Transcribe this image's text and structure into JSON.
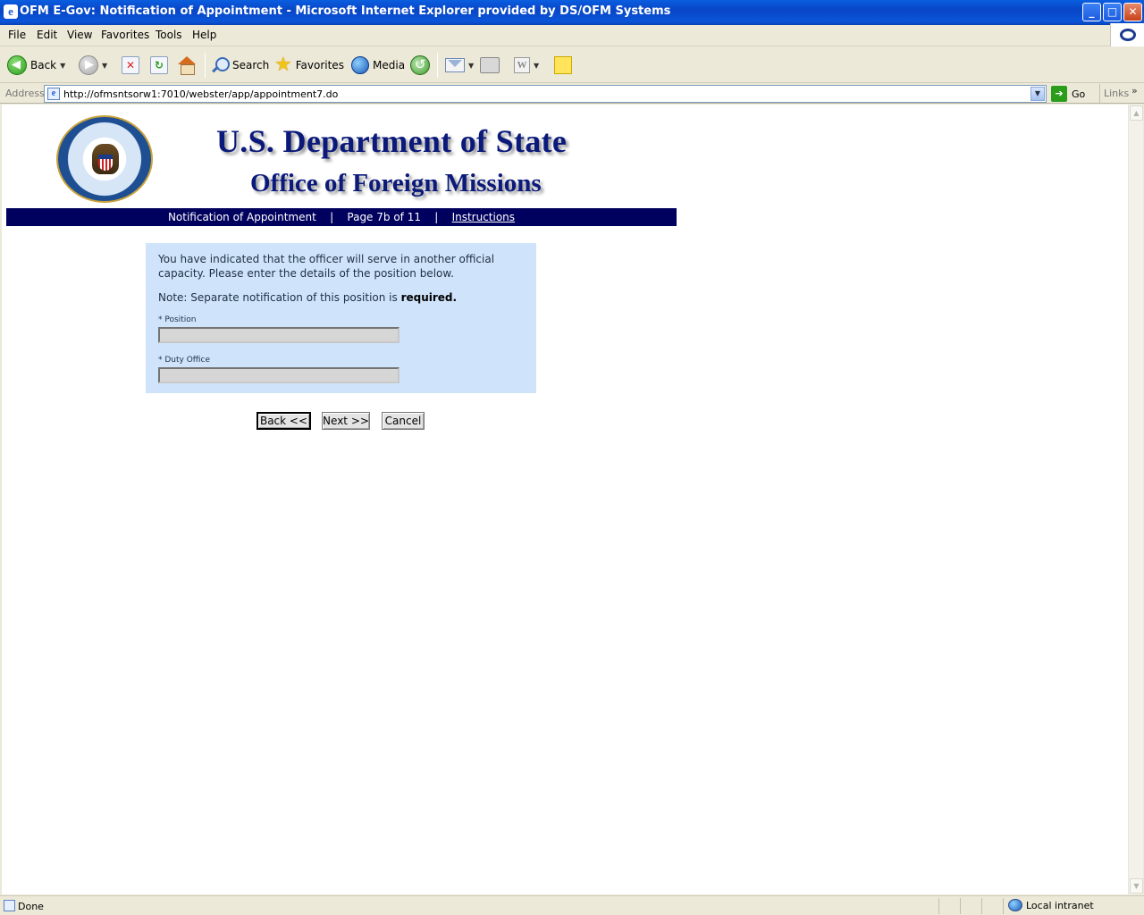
{
  "window": {
    "title": "OFM E-Gov: Notification of Appointment - Microsoft Internet Explorer provided by DS/OFM Systems",
    "controls": {
      "minimize": "_",
      "maximize": "□",
      "close": "✕"
    }
  },
  "menu": {
    "items": [
      "File",
      "Edit",
      "View",
      "Favorites",
      "Tools",
      "Help"
    ]
  },
  "toolbar": {
    "back_label": "Back",
    "search_label": "Search",
    "favorites_label": "Favorites",
    "media_label": "Media"
  },
  "address": {
    "label": "Address",
    "url": "http://ofmsntsorw1:7010/webster/app/appointment7.do",
    "go_label": "Go",
    "links_label": "Links",
    "links_chevron": "»"
  },
  "page": {
    "header": {
      "dept_title": "U.S. Department of State",
      "office_title": "Office of Foreign Missions"
    },
    "nav": {
      "section": "Notification of Appointment",
      "separator": "|",
      "page": "Page 7b of 11",
      "instructions_link": "Instructions"
    },
    "form": {
      "intro": "You have indicated that the officer will serve in another official capacity. Please enter the details of the position below.",
      "note_prefix": "Note: Separate notification of this position is ",
      "note_emphasis": "required.",
      "fields": [
        {
          "label": "* Position",
          "value": ""
        },
        {
          "label": "* Duty Office",
          "value": ""
        }
      ]
    },
    "buttons": {
      "back": "Back <<",
      "next": "Next >>",
      "cancel": "Cancel"
    }
  },
  "status": {
    "text": "Done",
    "zone": "Local intranet"
  },
  "icons": {
    "back": "back-arrow-icon",
    "forward": "forward-arrow-icon",
    "stop": "stop-icon",
    "refresh": "refresh-icon",
    "home": "home-icon",
    "search": "search-icon",
    "favorites": "favorites-star-icon",
    "media": "media-globe-icon",
    "history": "history-icon",
    "mail": "mail-icon",
    "print": "print-icon",
    "edit": "edit-word-icon",
    "messenger": "note-icon"
  },
  "colors": {
    "titlebar": "#0a55d9",
    "nav_band": "#00005e",
    "form_bg": "#cfe4fb",
    "heading_text": "#0b1a7a"
  }
}
